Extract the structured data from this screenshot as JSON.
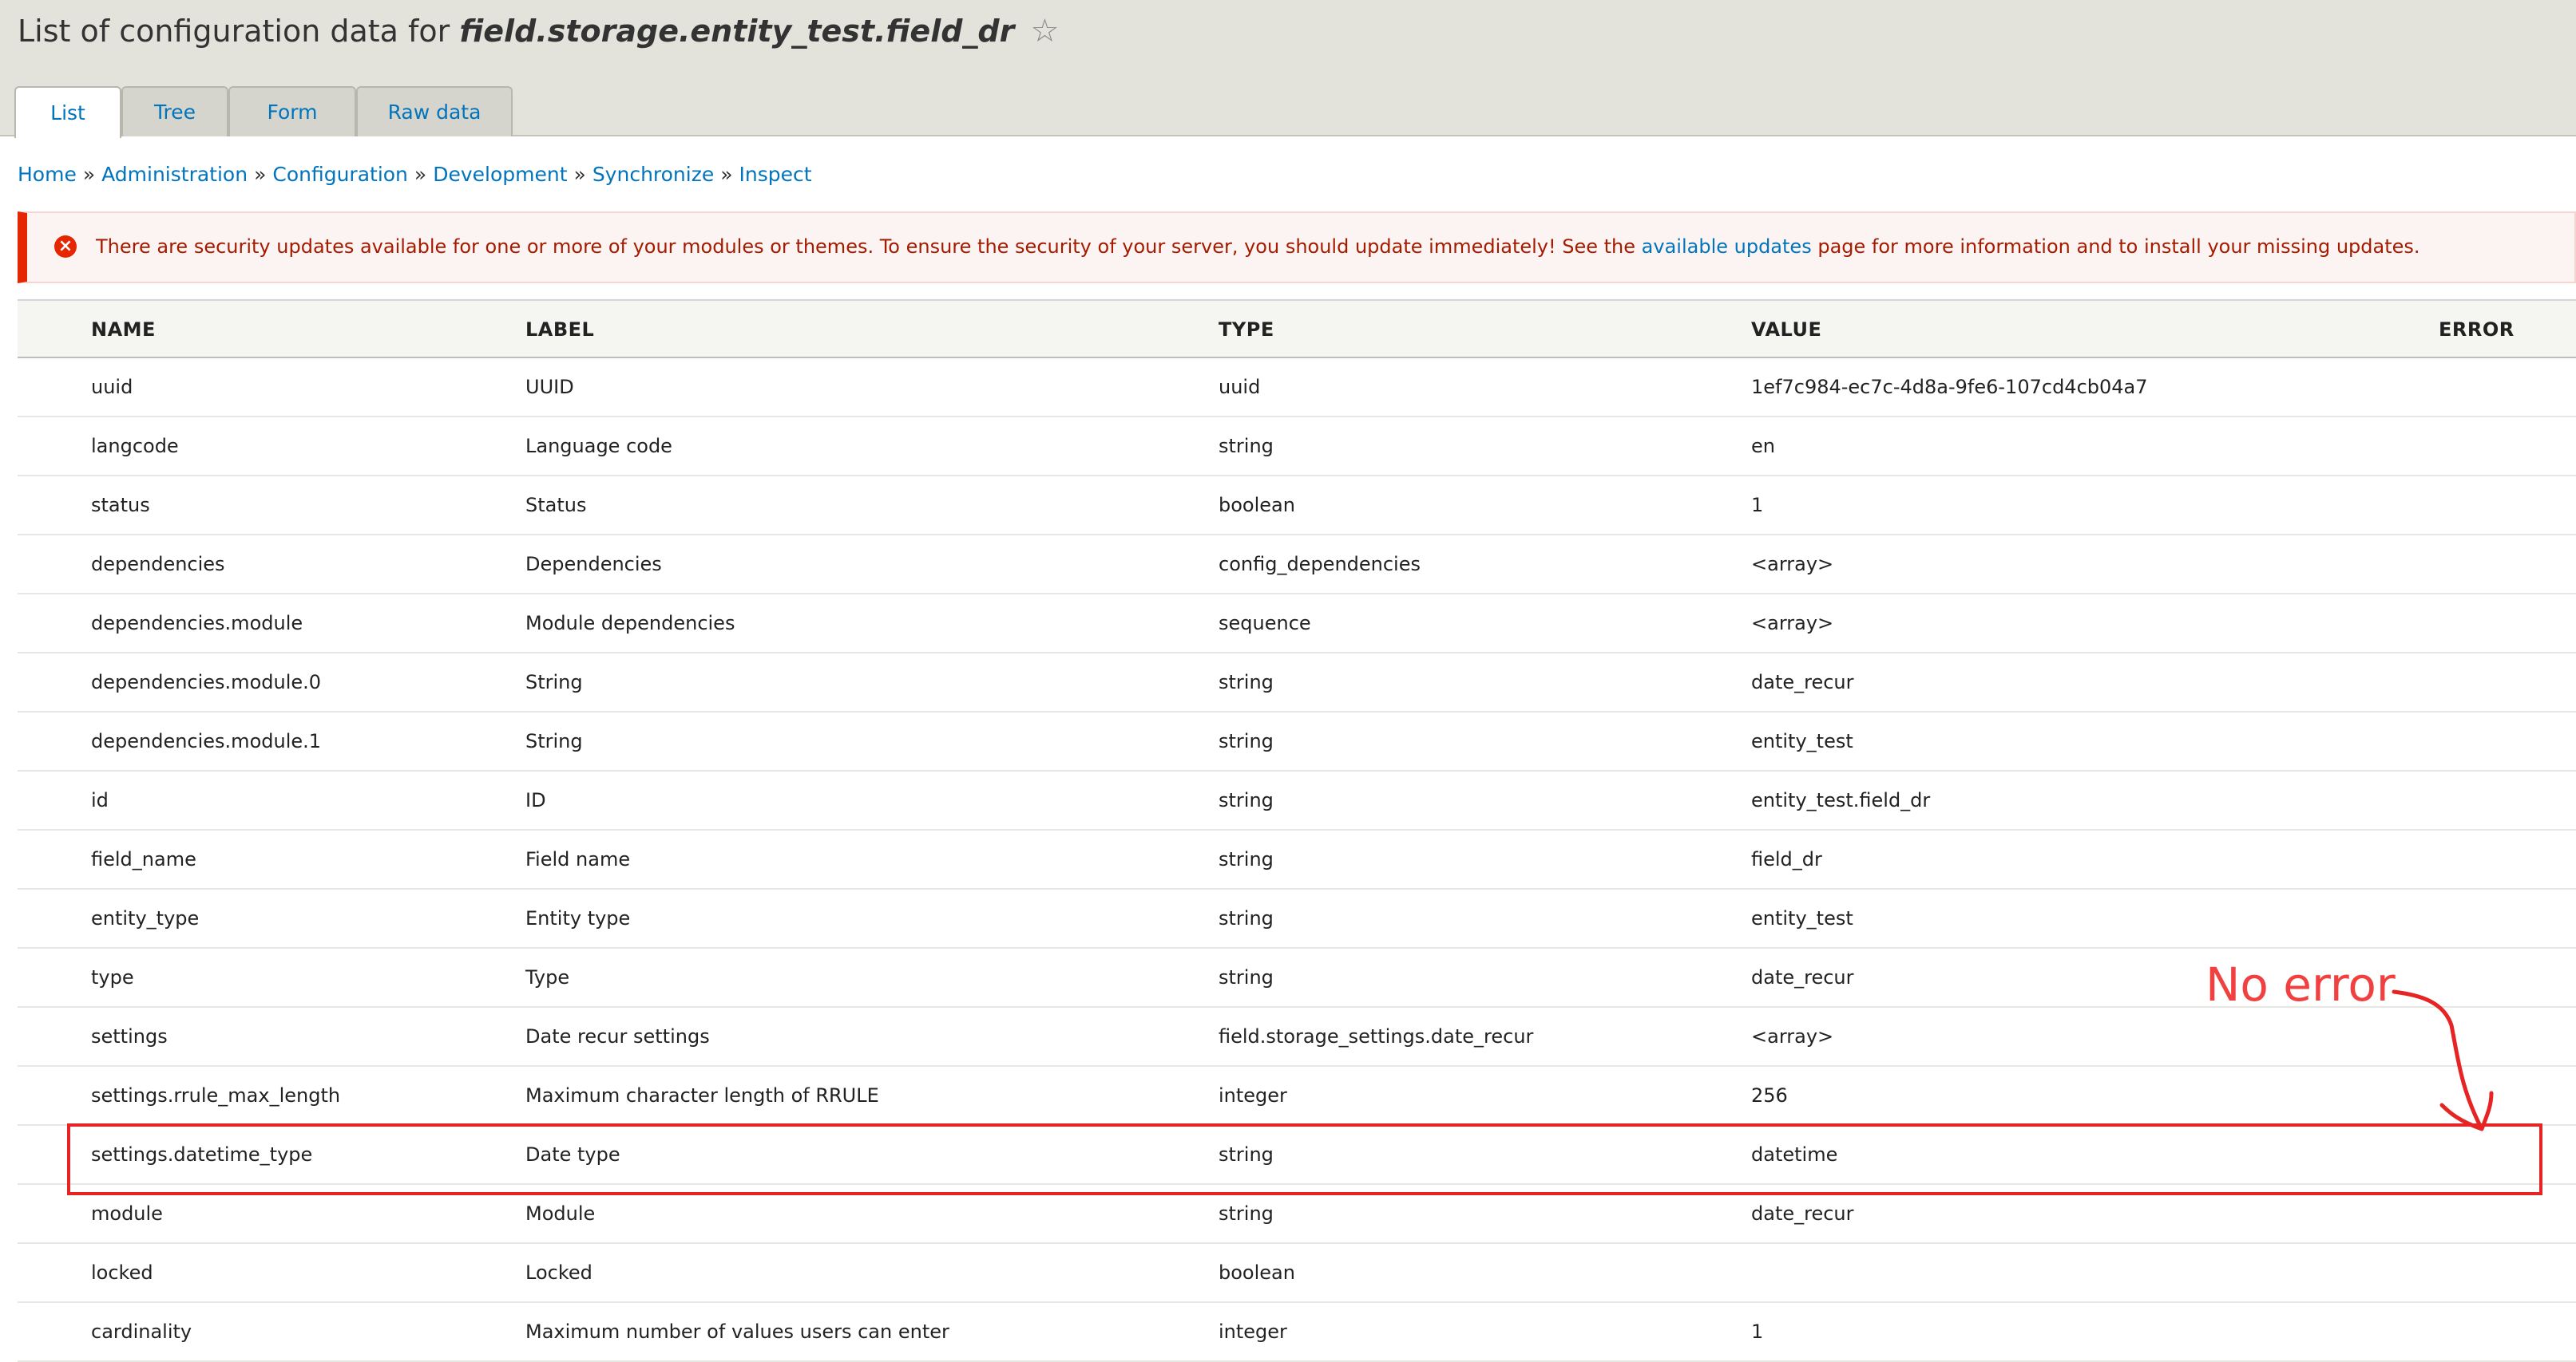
{
  "header": {
    "title_prefix": "List of configuration data for",
    "title_entity": "field.storage.entity_test.field_dr",
    "favorite_icon": "star-icon"
  },
  "tabs": [
    {
      "label": "List",
      "active": true
    },
    {
      "label": "Tree",
      "active": false
    },
    {
      "label": "Form",
      "active": false
    },
    {
      "label": "Raw data",
      "active": false
    }
  ],
  "breadcrumb": [
    "Home",
    "Administration",
    "Configuration",
    "Development",
    "Synchronize",
    "Inspect"
  ],
  "alert": {
    "icon": "error-icon",
    "text_before": "There are security updates available for one or more of your modules or themes. To ensure the security of your server, you should update immediately! See the",
    "link": "available updates",
    "text_after": "page for more information and to install your missing updates."
  },
  "table": {
    "headers": [
      "NAME",
      "LABEL",
      "TYPE",
      "VALUE",
      "ERROR"
    ],
    "rows": [
      {
        "name": "uuid",
        "label": "UUID",
        "type": "uuid",
        "value": "1ef7c984-ec7c-4d8a-9fe6-107cd4cb04a7",
        "error": ""
      },
      {
        "name": "langcode",
        "label": "Language code",
        "type": "string",
        "value": "en",
        "error": ""
      },
      {
        "name": "status",
        "label": "Status",
        "type": "boolean",
        "value": "1",
        "error": ""
      },
      {
        "name": "dependencies",
        "label": "Dependencies",
        "type": "config_dependencies",
        "value": "<array>",
        "error": ""
      },
      {
        "name": "dependencies.module",
        "label": "Module dependencies",
        "type": "sequence",
        "value": "<array>",
        "error": ""
      },
      {
        "name": "dependencies.module.0",
        "label": "String",
        "type": "string",
        "value": "date_recur",
        "error": ""
      },
      {
        "name": "dependencies.module.1",
        "label": "String",
        "type": "string",
        "value": "entity_test",
        "error": ""
      },
      {
        "name": "id",
        "label": "ID",
        "type": "string",
        "value": "entity_test.field_dr",
        "error": ""
      },
      {
        "name": "field_name",
        "label": "Field name",
        "type": "string",
        "value": "field_dr",
        "error": ""
      },
      {
        "name": "entity_type",
        "label": "Entity type",
        "type": "string",
        "value": "entity_test",
        "error": ""
      },
      {
        "name": "type",
        "label": "Type",
        "type": "string",
        "value": "date_recur",
        "error": ""
      },
      {
        "name": "settings",
        "label": "Date recur settings",
        "type": "field.storage_settings.date_recur",
        "value": "<array>",
        "error": ""
      },
      {
        "name": "settings.rrule_max_length",
        "label": "Maximum character length of RRULE",
        "type": "integer",
        "value": "256",
        "error": ""
      },
      {
        "name": "settings.datetime_type",
        "label": "Date type",
        "type": "string",
        "value": "datetime",
        "error": ""
      },
      {
        "name": "module",
        "label": "Module",
        "type": "string",
        "value": "date_recur",
        "error": ""
      },
      {
        "name": "locked",
        "label": "Locked",
        "type": "boolean",
        "value": "",
        "error": ""
      },
      {
        "name": "cardinality",
        "label": "Maximum number of values users can enter",
        "type": "integer",
        "value": "1",
        "error": ""
      }
    ]
  },
  "annotation": {
    "text": "No error",
    "color": "#f04040"
  },
  "colors": {
    "link": "#0074bd",
    "header_bg": "#e3e2db",
    "alert_red": "#e62600"
  }
}
